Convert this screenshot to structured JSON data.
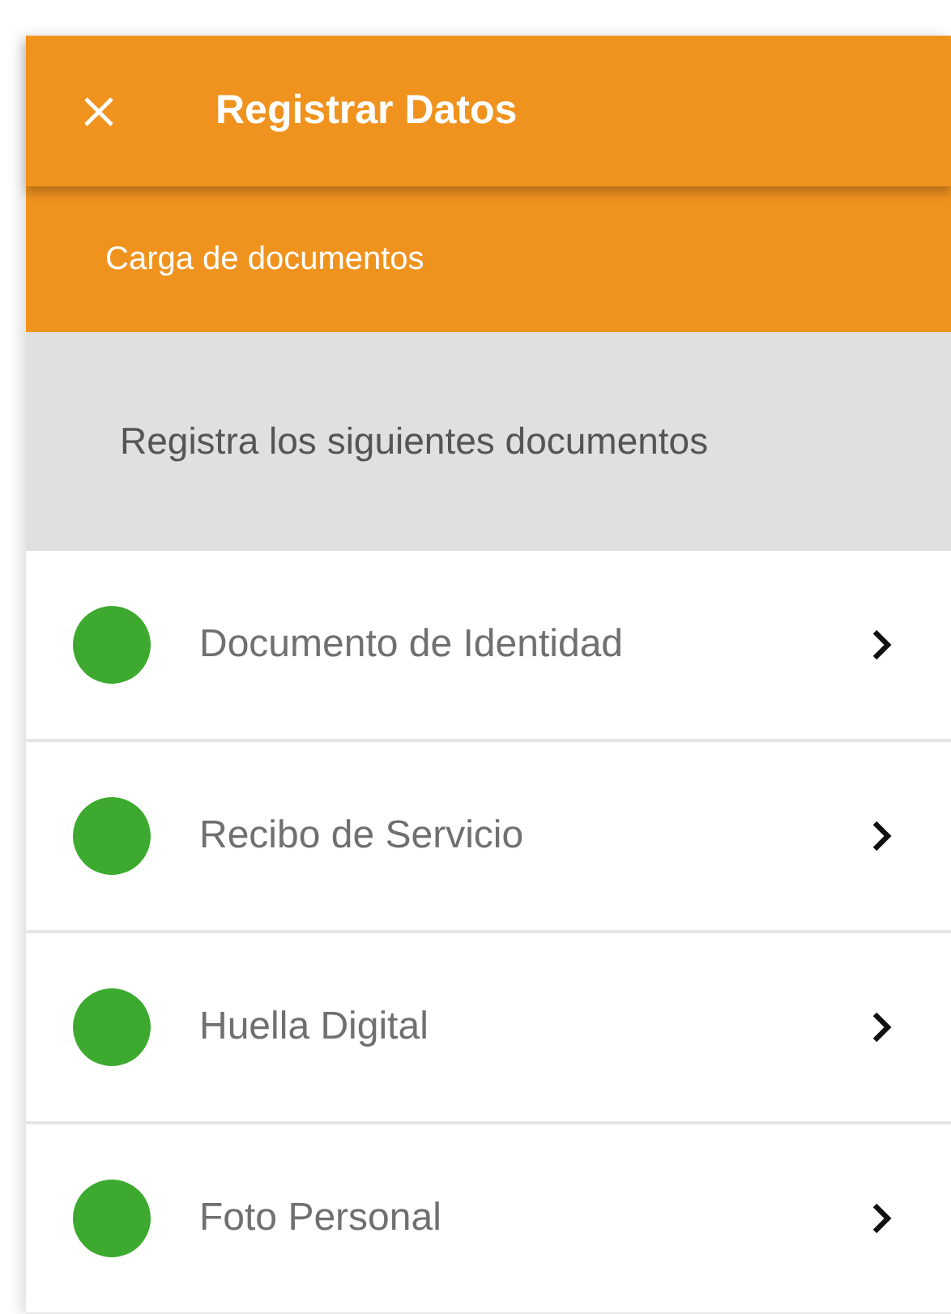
{
  "header": {
    "title": "Registrar Datos"
  },
  "subheader": {
    "label": "Carga de documentos"
  },
  "section": {
    "heading": "Registra los siguientes documentos"
  },
  "documents": [
    {
      "label": "Documento de Identidad",
      "color": "#3daa2f"
    },
    {
      "label": "Recibo de Servicio",
      "color": "#3daa2f"
    },
    {
      "label": "Huella Digital",
      "color": "#3daa2f"
    },
    {
      "label": "Foto Personal",
      "color": "#3daa2f"
    }
  ]
}
